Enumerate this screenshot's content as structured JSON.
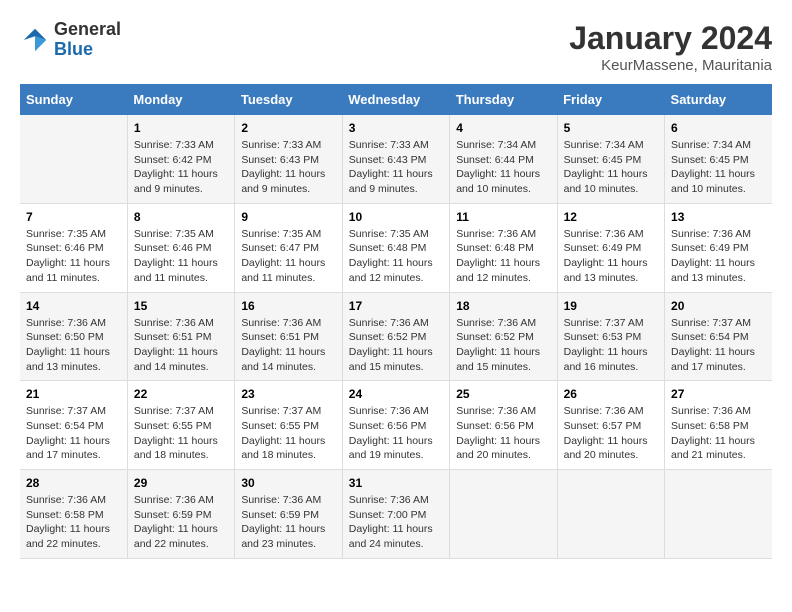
{
  "logo": {
    "general": "General",
    "blue": "Blue"
  },
  "title": "January 2024",
  "subtitle": "KeurMassene, Mauritania",
  "weekdays": [
    "Sunday",
    "Monday",
    "Tuesday",
    "Wednesday",
    "Thursday",
    "Friday",
    "Saturday"
  ],
  "weeks": [
    [
      {
        "day": "",
        "info": ""
      },
      {
        "day": "1",
        "info": "Sunrise: 7:33 AM\nSunset: 6:42 PM\nDaylight: 11 hours\nand 9 minutes."
      },
      {
        "day": "2",
        "info": "Sunrise: 7:33 AM\nSunset: 6:43 PM\nDaylight: 11 hours\nand 9 minutes."
      },
      {
        "day": "3",
        "info": "Sunrise: 7:33 AM\nSunset: 6:43 PM\nDaylight: 11 hours\nand 9 minutes."
      },
      {
        "day": "4",
        "info": "Sunrise: 7:34 AM\nSunset: 6:44 PM\nDaylight: 11 hours\nand 10 minutes."
      },
      {
        "day": "5",
        "info": "Sunrise: 7:34 AM\nSunset: 6:45 PM\nDaylight: 11 hours\nand 10 minutes."
      },
      {
        "day": "6",
        "info": "Sunrise: 7:34 AM\nSunset: 6:45 PM\nDaylight: 11 hours\nand 10 minutes."
      }
    ],
    [
      {
        "day": "7",
        "info": "Sunrise: 7:35 AM\nSunset: 6:46 PM\nDaylight: 11 hours\nand 11 minutes."
      },
      {
        "day": "8",
        "info": "Sunrise: 7:35 AM\nSunset: 6:46 PM\nDaylight: 11 hours\nand 11 minutes."
      },
      {
        "day": "9",
        "info": "Sunrise: 7:35 AM\nSunset: 6:47 PM\nDaylight: 11 hours\nand 11 minutes."
      },
      {
        "day": "10",
        "info": "Sunrise: 7:35 AM\nSunset: 6:48 PM\nDaylight: 11 hours\nand 12 minutes."
      },
      {
        "day": "11",
        "info": "Sunrise: 7:36 AM\nSunset: 6:48 PM\nDaylight: 11 hours\nand 12 minutes."
      },
      {
        "day": "12",
        "info": "Sunrise: 7:36 AM\nSunset: 6:49 PM\nDaylight: 11 hours\nand 13 minutes."
      },
      {
        "day": "13",
        "info": "Sunrise: 7:36 AM\nSunset: 6:49 PM\nDaylight: 11 hours\nand 13 minutes."
      }
    ],
    [
      {
        "day": "14",
        "info": "Sunrise: 7:36 AM\nSunset: 6:50 PM\nDaylight: 11 hours\nand 13 minutes."
      },
      {
        "day": "15",
        "info": "Sunrise: 7:36 AM\nSunset: 6:51 PM\nDaylight: 11 hours\nand 14 minutes."
      },
      {
        "day": "16",
        "info": "Sunrise: 7:36 AM\nSunset: 6:51 PM\nDaylight: 11 hours\nand 14 minutes."
      },
      {
        "day": "17",
        "info": "Sunrise: 7:36 AM\nSunset: 6:52 PM\nDaylight: 11 hours\nand 15 minutes."
      },
      {
        "day": "18",
        "info": "Sunrise: 7:36 AM\nSunset: 6:52 PM\nDaylight: 11 hours\nand 15 minutes."
      },
      {
        "day": "19",
        "info": "Sunrise: 7:37 AM\nSunset: 6:53 PM\nDaylight: 11 hours\nand 16 minutes."
      },
      {
        "day": "20",
        "info": "Sunrise: 7:37 AM\nSunset: 6:54 PM\nDaylight: 11 hours\nand 17 minutes."
      }
    ],
    [
      {
        "day": "21",
        "info": "Sunrise: 7:37 AM\nSunset: 6:54 PM\nDaylight: 11 hours\nand 17 minutes."
      },
      {
        "day": "22",
        "info": "Sunrise: 7:37 AM\nSunset: 6:55 PM\nDaylight: 11 hours\nand 18 minutes."
      },
      {
        "day": "23",
        "info": "Sunrise: 7:37 AM\nSunset: 6:55 PM\nDaylight: 11 hours\nand 18 minutes."
      },
      {
        "day": "24",
        "info": "Sunrise: 7:36 AM\nSunset: 6:56 PM\nDaylight: 11 hours\nand 19 minutes."
      },
      {
        "day": "25",
        "info": "Sunrise: 7:36 AM\nSunset: 6:56 PM\nDaylight: 11 hours\nand 20 minutes."
      },
      {
        "day": "26",
        "info": "Sunrise: 7:36 AM\nSunset: 6:57 PM\nDaylight: 11 hours\nand 20 minutes."
      },
      {
        "day": "27",
        "info": "Sunrise: 7:36 AM\nSunset: 6:58 PM\nDaylight: 11 hours\nand 21 minutes."
      }
    ],
    [
      {
        "day": "28",
        "info": "Sunrise: 7:36 AM\nSunset: 6:58 PM\nDaylight: 11 hours\nand 22 minutes."
      },
      {
        "day": "29",
        "info": "Sunrise: 7:36 AM\nSunset: 6:59 PM\nDaylight: 11 hours\nand 22 minutes."
      },
      {
        "day": "30",
        "info": "Sunrise: 7:36 AM\nSunset: 6:59 PM\nDaylight: 11 hours\nand 23 minutes."
      },
      {
        "day": "31",
        "info": "Sunrise: 7:36 AM\nSunset: 7:00 PM\nDaylight: 11 hours\nand 24 minutes."
      },
      {
        "day": "",
        "info": ""
      },
      {
        "day": "",
        "info": ""
      },
      {
        "day": "",
        "info": ""
      }
    ]
  ]
}
